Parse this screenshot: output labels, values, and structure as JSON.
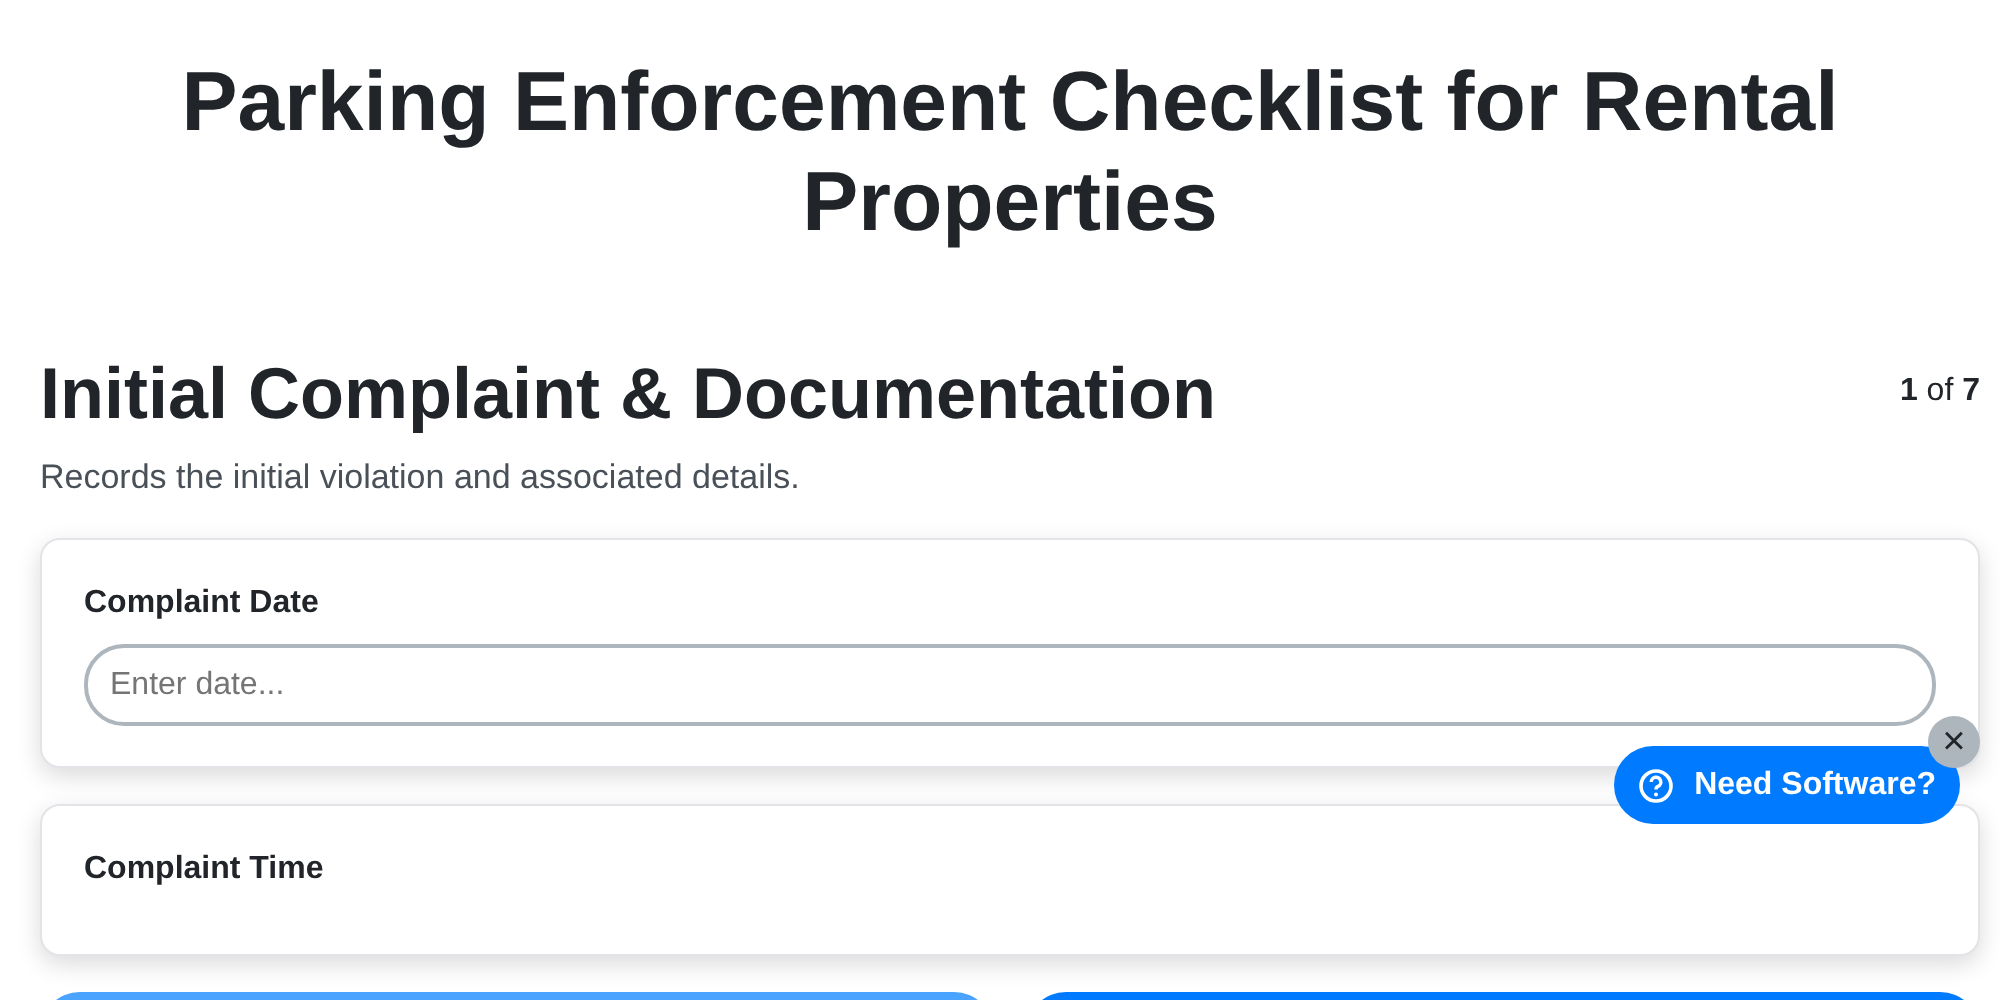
{
  "title": "Parking Enforcement Checklist for Rental Properties",
  "section": {
    "heading": "Initial Complaint & Documentation",
    "counter": "**1** of **7**",
    "description": "Records the initial violation and associated details."
  },
  "fields": [
    {
      "label": "Complaint Date",
      "placeholder": "Enter date..."
    },
    {
      "label": "Complaint Time"
    }
  ],
  "nav_buttons": [
    {
      "disabled": true
    },
    {
      "disabled": false
    }
  ],
  "help_widget": {
    "label": "Need Software?",
    "close": "×"
  }
}
